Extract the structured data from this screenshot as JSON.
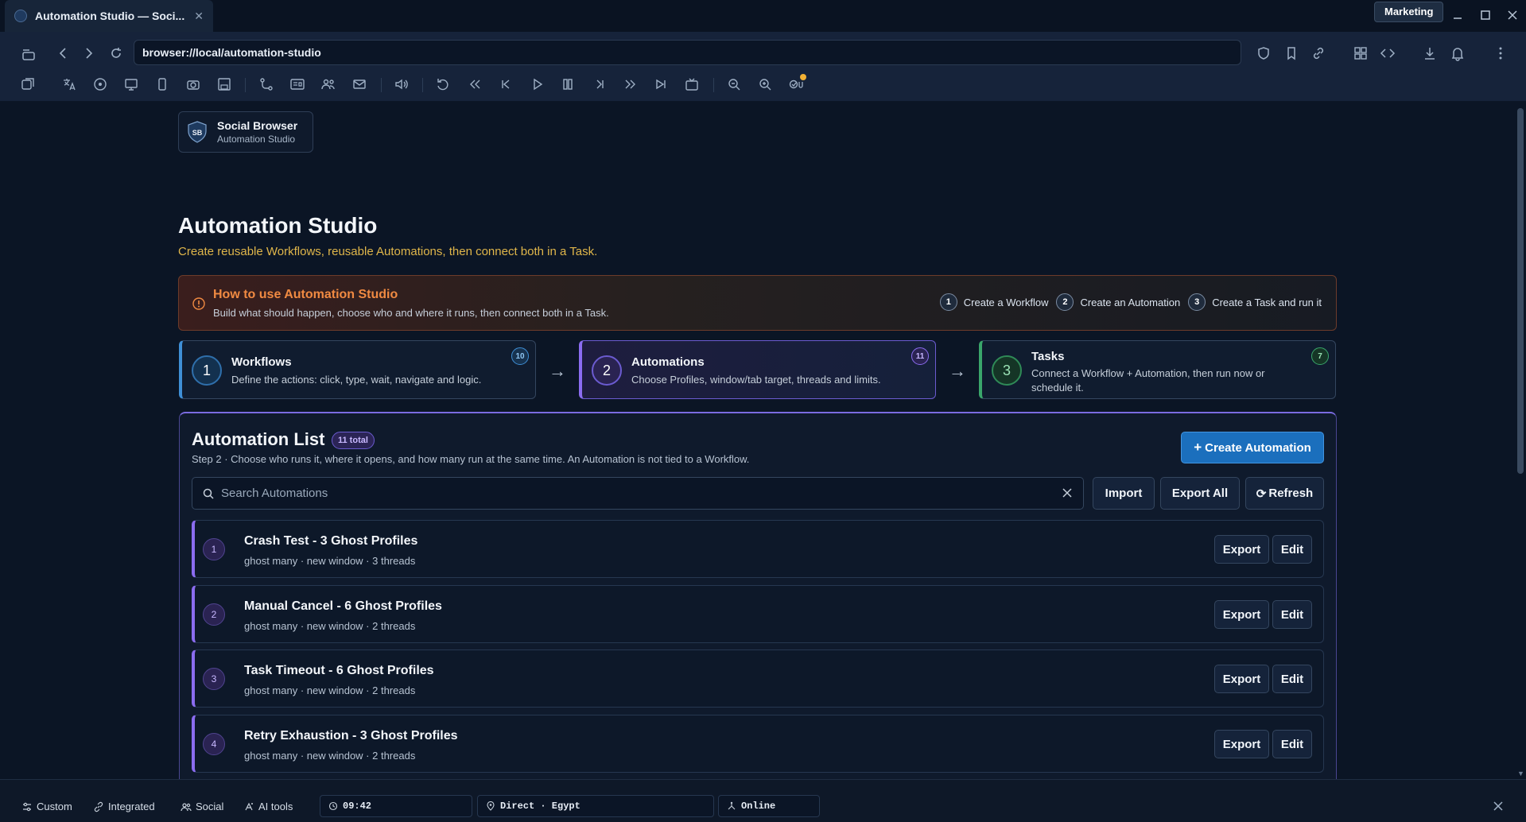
{
  "window": {
    "tab_title": "Automation Studio — Soci...",
    "profile": "Marketing"
  },
  "address_bar": {
    "url": "browser://local/automation-studio"
  },
  "brand": {
    "logo_text": "SB",
    "name": "Social Browser",
    "subtitle": "Automation Studio"
  },
  "page": {
    "title": "Automation Studio",
    "subtitle": "Create reusable Workflows, reusable Automations, then connect both in a Task."
  },
  "howto": {
    "title": "How to use Automation Studio",
    "text": "Build what should happen, choose who and where it runs, then connect both in a Task.",
    "steps": [
      {
        "num": "1",
        "label": "Create a Workflow"
      },
      {
        "num": "2",
        "label": "Create an Automation"
      },
      {
        "num": "3",
        "label": "Create a Task and run it"
      }
    ]
  },
  "step_cards": [
    {
      "num": "1",
      "title": "Workflows",
      "desc": "Define the actions: click, type, wait, navigate and logic.",
      "count": "10"
    },
    {
      "num": "2",
      "title": "Automations",
      "desc": "Choose Profiles, window/tab target, threads and limits.",
      "count": "11"
    },
    {
      "num": "3",
      "title": "Tasks",
      "desc": "Connect a Workflow + Automation, then run now or schedule it.",
      "count": "7"
    }
  ],
  "flow_arrow": "→",
  "list": {
    "title": "Automation List",
    "total_badge": "11 total",
    "description": "Step 2 · Choose who runs it, where it opens, and how many run at the same time. An Automation is not tied to a Workflow.",
    "create_label": "Create Automation",
    "search_placeholder": "Search Automations",
    "import_label": "Import",
    "export_all_label": "Export All",
    "refresh_label": "Refresh",
    "items": [
      {
        "num": "1",
        "title": "Crash Test - 3 Ghost Profiles",
        "meta": "ghost many · new window · 3 threads",
        "export": "Export",
        "edit": "Edit"
      },
      {
        "num": "2",
        "title": "Manual Cancel - 6 Ghost Profiles",
        "meta": "ghost many · new window · 2 threads",
        "export": "Export",
        "edit": "Edit"
      },
      {
        "num": "3",
        "title": "Task Timeout - 6 Ghost Profiles",
        "meta": "ghost many · new window · 2 threads",
        "export": "Export",
        "edit": "Edit"
      },
      {
        "num": "4",
        "title": "Retry Exhaustion - 3 Ghost Profiles",
        "meta": "ghost many · new window · 2 threads",
        "export": "Export",
        "edit": "Edit"
      }
    ]
  },
  "statusbar": {
    "custom": "Custom",
    "integrated": "Integrated",
    "social": "Social",
    "ai_tools": "AI tools",
    "time": "09:42",
    "location": "Direct · Egypt",
    "network": "Online"
  },
  "colors": {
    "background": "#0b1525",
    "accent_blue": "#1b6fbd",
    "accent_purple": "#8b6cf0",
    "accent_green": "#3aa66b",
    "warning_orange": "#f08a42",
    "subtitle_gold": "#e0b64a"
  }
}
